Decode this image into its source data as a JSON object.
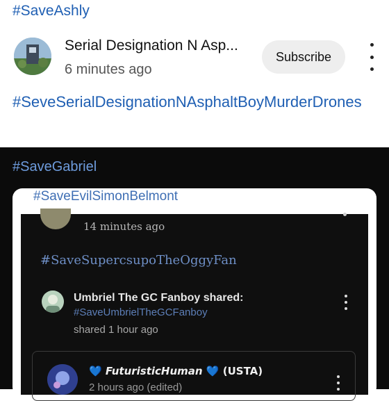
{
  "post": {
    "hashtag_top": "#SaveAshly",
    "author": "Serial Designation N  Asp...",
    "time": "6 minutes ago",
    "subscribe_label": "Subscribe",
    "hashtag_long": "#SeveSerialDesignationNAsphaltBoyMurderDrones"
  },
  "shared_screenshot": {
    "hashtag": "#SaveGabriel",
    "card_hashtag": "#SaveEvilSimonBelmont",
    "inner_time": "14 minutes ago",
    "inner_hashtag": "#SaveSupercsupoTheOggyFan",
    "shared_title": "Umbriel The GC Fanboy shared:",
    "shared_link": "#SaveUmbrielTheGCFanboy",
    "shared_time": "shared 1 hour ago",
    "quote_name": "FuturisticHuman",
    "quote_tag": "(USTA)",
    "quote_time": "2 hours ago (edited)",
    "heart_glyph": "💙"
  },
  "colors": {
    "link_blue": "#1f5fb3",
    "dark_bg": "#0b0b0b",
    "heart_blue": "#3b8cf0"
  }
}
